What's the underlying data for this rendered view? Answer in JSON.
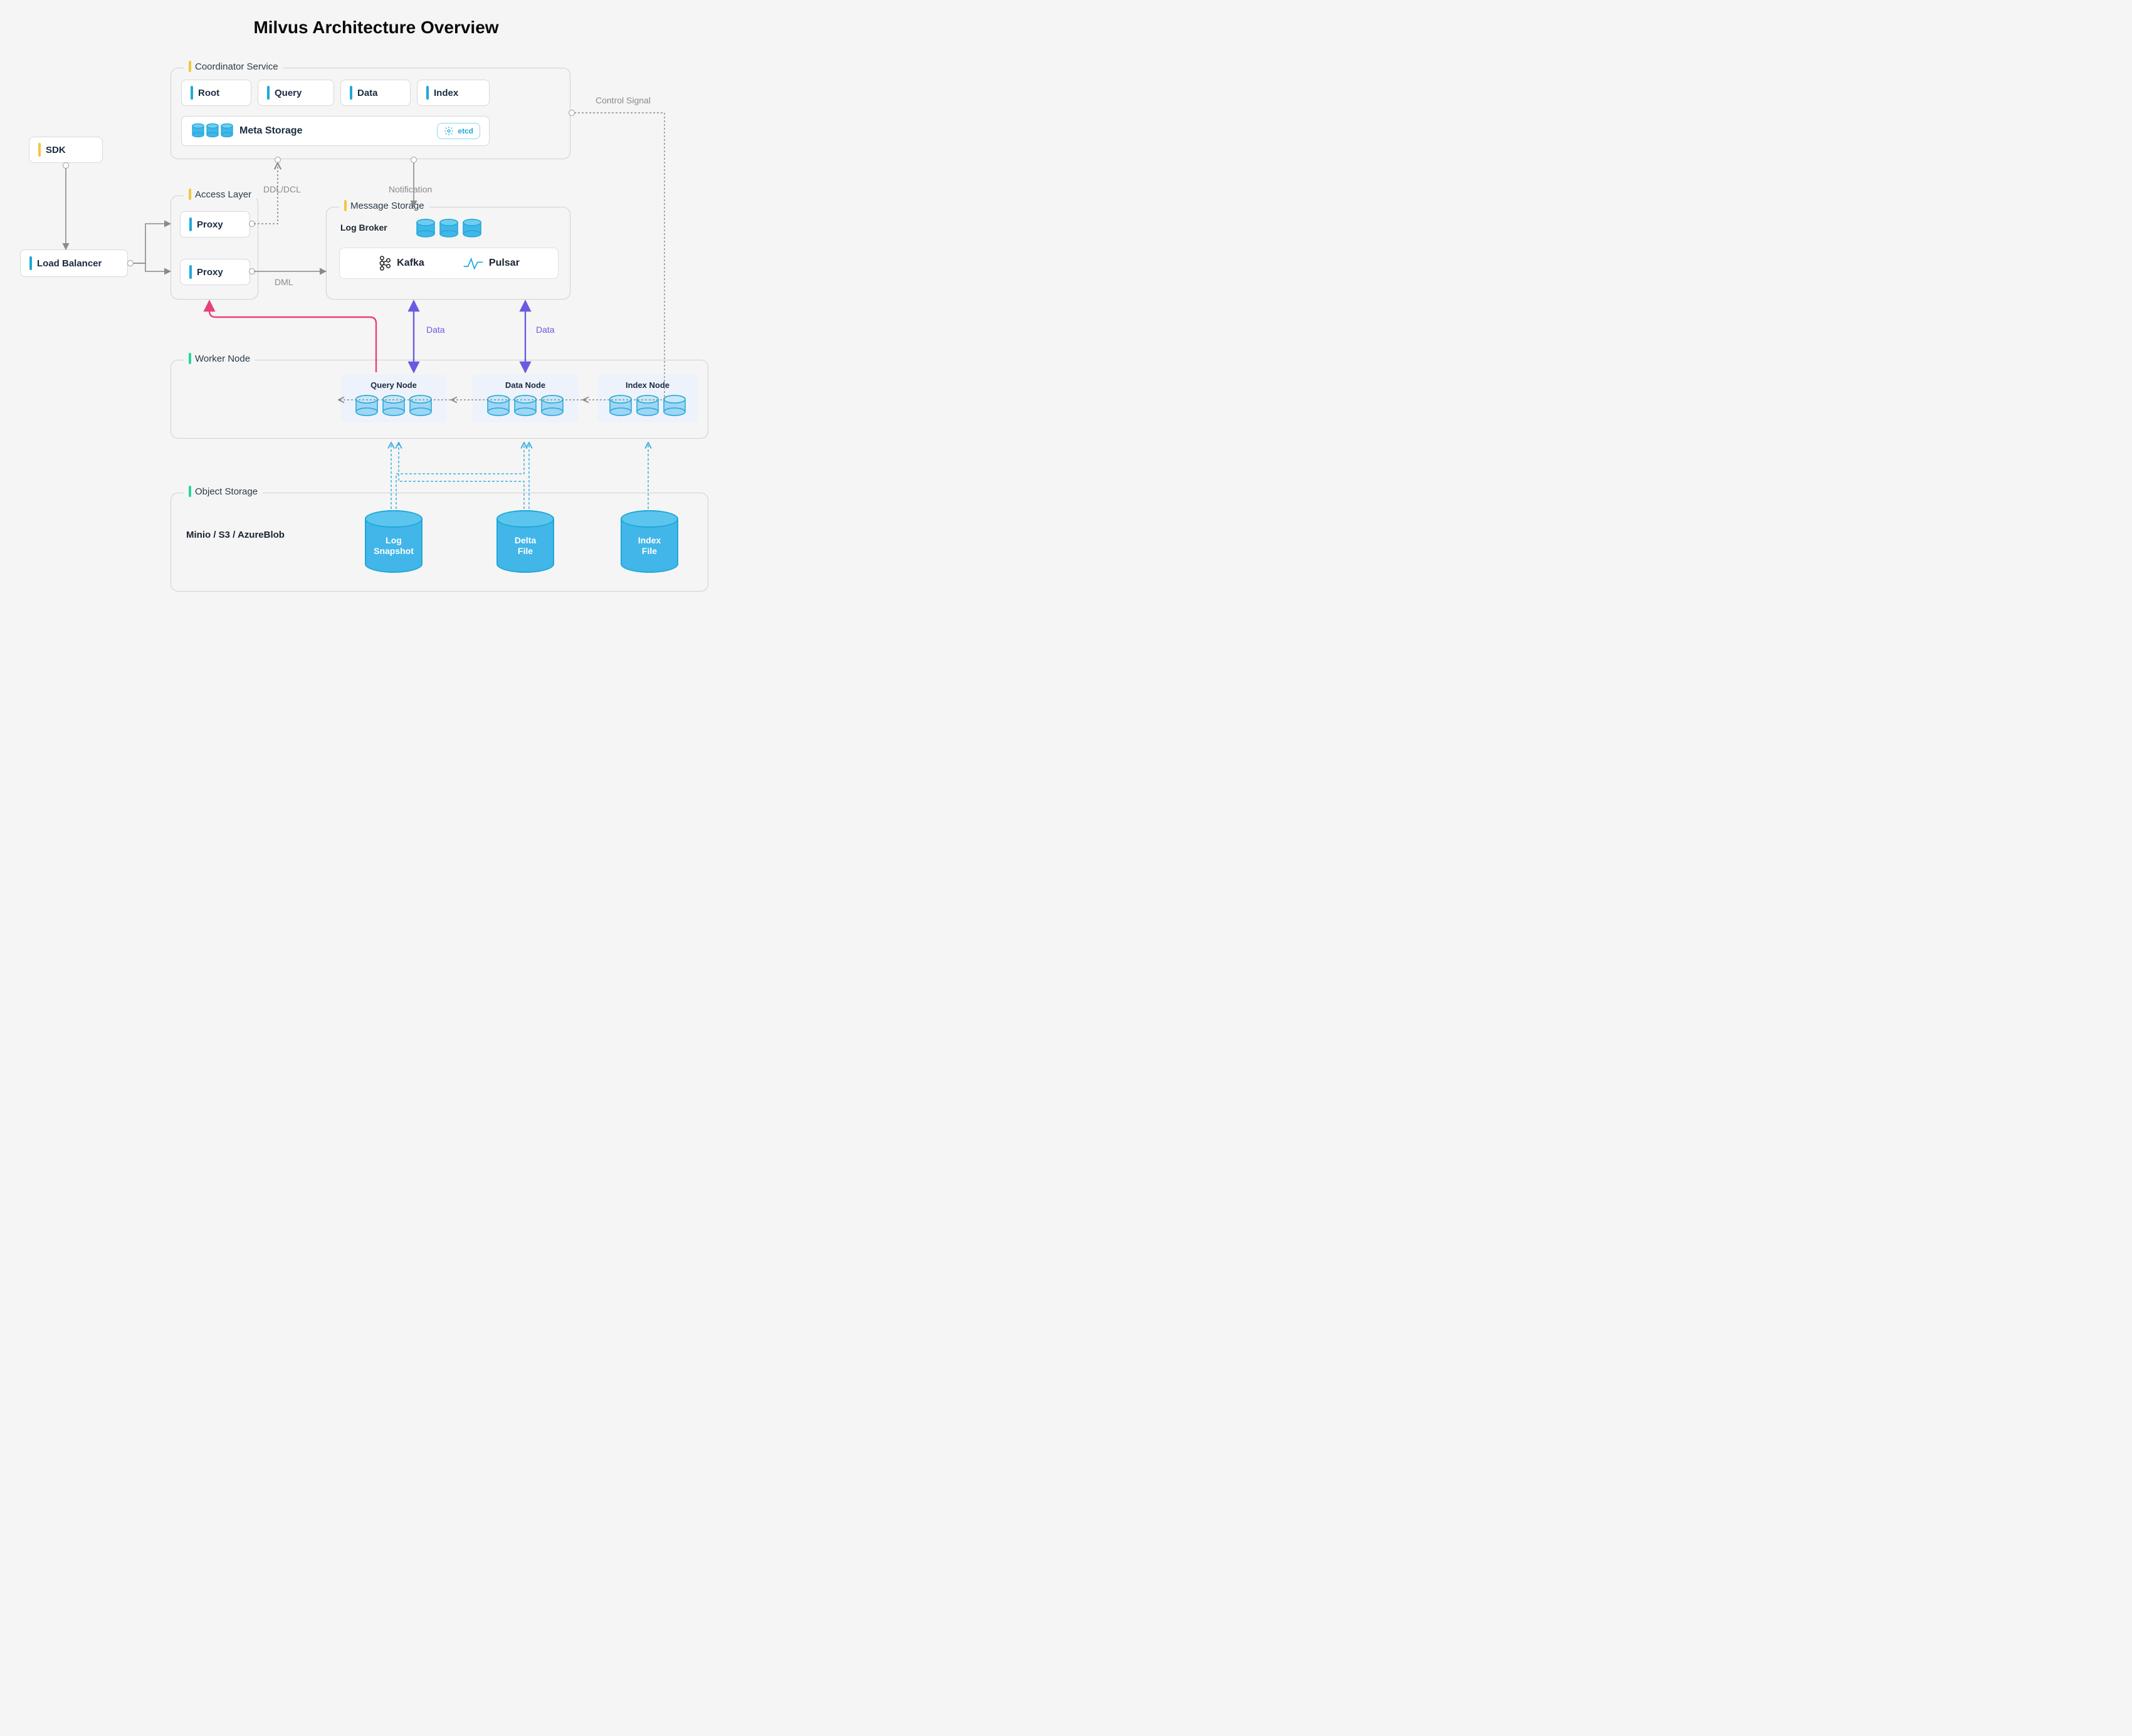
{
  "title": "Milvus Architecture Overview",
  "sdk": {
    "label": "SDK"
  },
  "load_balancer": {
    "label": "Load Balancer"
  },
  "coordinator": {
    "title": "Coordinator Service",
    "boxes": {
      "root": "Root",
      "query": "Query",
      "data": "Data",
      "index": "Index"
    },
    "meta_storage": "Meta Storage",
    "etcd": "etcd"
  },
  "access_layer": {
    "title": "Access Layer",
    "proxy1": "Proxy",
    "proxy2": "Proxy"
  },
  "message_storage": {
    "title": "Message Storage",
    "log_broker": "Log Broker",
    "kafka": "Kafka",
    "pulsar": "Pulsar"
  },
  "worker_node": {
    "title": "Worker Node",
    "query_node": "Query Node",
    "data_node": "Data Node",
    "index_node": "Index Node"
  },
  "object_storage": {
    "title": "Object Storage",
    "providers": "Minio / S3 / AzureBlob",
    "log_snapshot": "Log\nSnapshot",
    "delta_file": "Delta\nFile",
    "index_file": "Index\nFile"
  },
  "labels": {
    "ddl_dcl": "DDL/DCL",
    "notification": "Notification",
    "dml": "DML",
    "control_signal": "Control Signal",
    "data1": "Data",
    "data2": "Data"
  },
  "colors": {
    "yellow": "#f5c542",
    "green": "#2dd4a0",
    "blue": "#1fa8d8",
    "purple": "#6a5ae0",
    "pink": "#e8417a",
    "grey": "#8a8a8a"
  }
}
